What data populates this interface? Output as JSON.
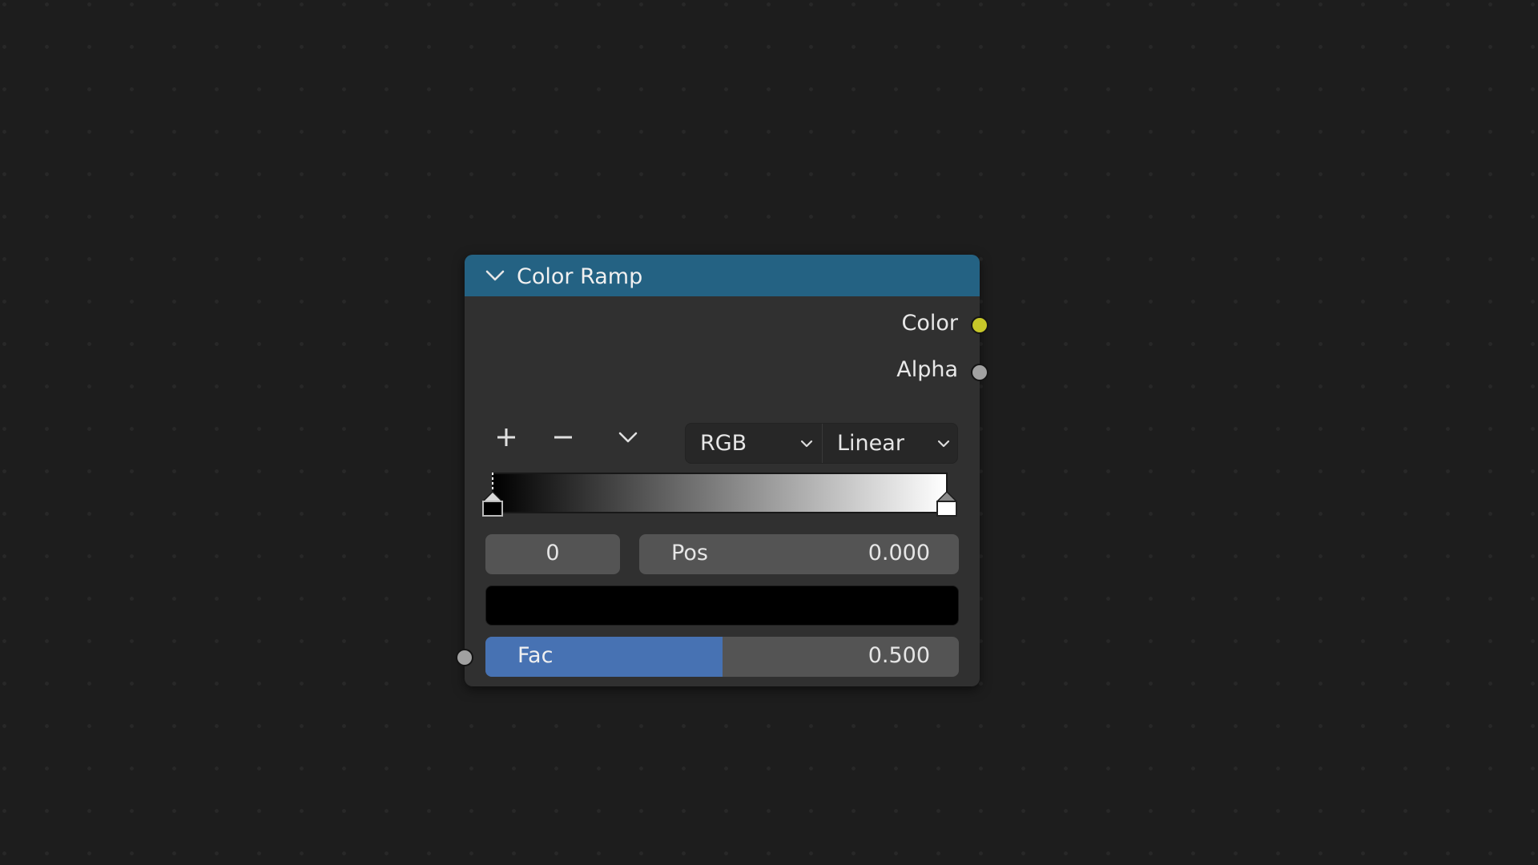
{
  "node": {
    "title": "Color Ramp",
    "header_color": "#246283",
    "outputs": [
      {
        "label": "Color",
        "socket_color": "#c7c729"
      },
      {
        "label": "Alpha",
        "socket_color": "#a1a1a1"
      }
    ],
    "inputs": [
      {
        "label": "Fac",
        "socket_color": "#a1a1a1"
      }
    ]
  },
  "toolbar": {
    "add_icon": "plus-icon",
    "remove_icon": "minus-icon",
    "menu_icon": "chevron-down-icon",
    "color_mode": "RGB",
    "interpolation": "Linear"
  },
  "ramp": {
    "stops": [
      {
        "position": 0.0,
        "color": "#000000",
        "active": true
      },
      {
        "position": 1.0,
        "color": "#ffffff",
        "active": false
      }
    ]
  },
  "active_stop": {
    "index": "0",
    "pos_label": "Pos",
    "pos_value": "0.000",
    "color": "#000000"
  },
  "fac": {
    "label": "Fac",
    "value": "0.500",
    "fraction": 0.5
  }
}
